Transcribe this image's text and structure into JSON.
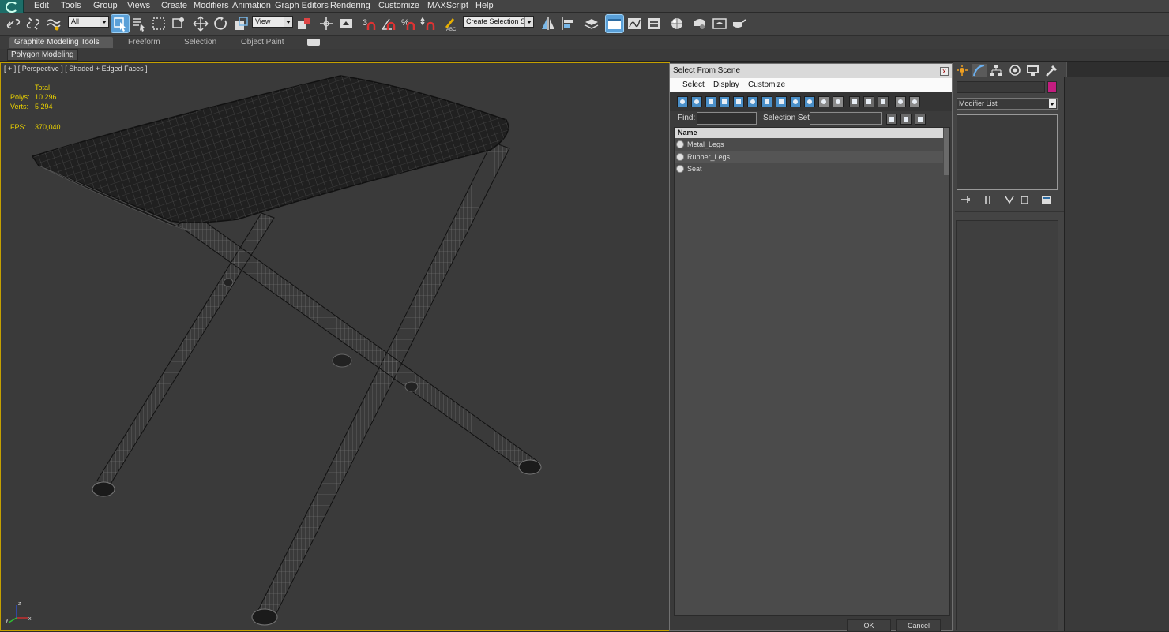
{
  "menubar": {
    "items": [
      "Edit",
      "Tools",
      "Group",
      "Views",
      "Create",
      "Modifiers",
      "Animation",
      "Graph Editors",
      "Rendering",
      "Customize",
      "MAXScript",
      "Help"
    ]
  },
  "toolbar": {
    "filter_combo": "All",
    "view_combo": "View",
    "selection_set_combo": "Create Selection Se",
    "snap_label": "3"
  },
  "ribbon": {
    "tabs": [
      "Graphite Modeling Tools",
      "Freeform",
      "Selection",
      "Object Paint"
    ],
    "active_tab": "Graphite Modeling Tools",
    "panel": "Polygon Modeling"
  },
  "viewport": {
    "label": "[ + ] [ Perspective ] [ Shaded + Edged Faces ]",
    "stats": {
      "total_label": "Total",
      "polys_label": "Polys:",
      "polys_value": "10 296",
      "verts_label": "Verts:",
      "verts_value": "5 294",
      "fps_label": "FPS:",
      "fps_value": "370,040"
    },
    "axis": {
      "x": "x",
      "y": "y",
      "z": "z"
    }
  },
  "dialog": {
    "title": "Select From Scene",
    "menu": [
      "Select",
      "Display",
      "Customize"
    ],
    "find_label": "Find:",
    "selection_set_label": "Selection Set:",
    "list_header": "Name",
    "items": [
      "Metal_Legs",
      "Rubber_Legs",
      "Seat"
    ],
    "ok_label": "OK",
    "cancel_label": "Cancel",
    "close_glyph": "x"
  },
  "command_panel": {
    "modifier_list": "Modifier List",
    "object_color": "#c41d80"
  },
  "colors": {
    "ui_bg": "#444444",
    "viewport_bg": "#3a3a3a",
    "active_viewport_border": "#c4a000",
    "stats_text": "#e8d000",
    "accent": "#5aa0d8"
  }
}
